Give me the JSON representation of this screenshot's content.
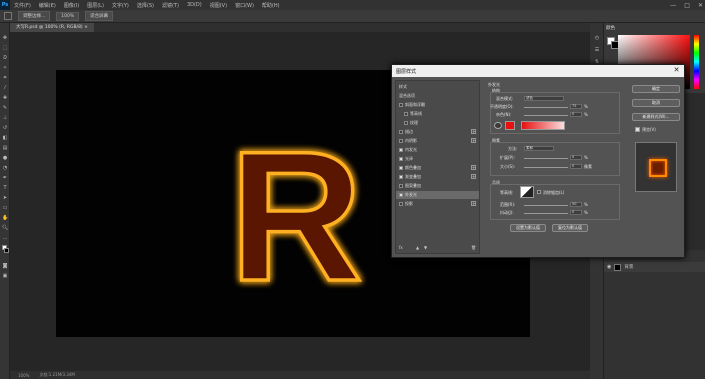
{
  "app": {
    "logo": "Ps"
  },
  "menu": [
    "文件(F)",
    "编辑(E)",
    "图像(I)",
    "图层(L)",
    "文字(Y)",
    "选择(S)",
    "滤镜(T)",
    "3D(D)",
    "视图(V)",
    "窗口(W)",
    "帮助(H)"
  ],
  "window_controls": {
    "minimize": "—",
    "maximize": "□",
    "close": "✕"
  },
  "options_bar": {
    "button1": "调整边缘...",
    "zoom": "100%",
    "button2": "适合屏幕"
  },
  "document_tab": "大写R.psd @ 100% (R, RGB/8) ×",
  "statusbar": {
    "zoom": "100%",
    "doc_info": "文档:1.21M/3.34M"
  },
  "color_panel": {
    "title": "颜色"
  },
  "canvas": {
    "glyph": "R",
    "glow_color": "#ff6a00",
    "fill_color": "#5a1800"
  },
  "dialog": {
    "title": "图层样式",
    "close": "✕",
    "styles": [
      {
        "label": "样式",
        "checked": null,
        "plus": false
      },
      {
        "label": "混合选项",
        "checked": null,
        "plus": false
      },
      {
        "label": "斜面和浮雕",
        "checked": false,
        "plus": false
      },
      {
        "label": "等高线",
        "checked": false,
        "plus": false
      },
      {
        "label": "纹理",
        "checked": false,
        "plus": false
      },
      {
        "label": "描边",
        "checked": false,
        "plus": true
      },
      {
        "label": "内阴影",
        "checked": false,
        "plus": true
      },
      {
        "label": "内发光",
        "checked": true,
        "plus": false
      },
      {
        "label": "光泽",
        "checked": true,
        "plus": false
      },
      {
        "label": "颜色叠加",
        "checked": true,
        "plus": true
      },
      {
        "label": "渐变叠加",
        "checked": true,
        "plus": true
      },
      {
        "label": "图案叠加",
        "checked": false,
        "plus": false
      },
      {
        "label": "外发光",
        "checked": true,
        "plus": false,
        "selected": true
      },
      {
        "label": "投影",
        "checked": false,
        "plus": true
      }
    ],
    "fx_label": "fx",
    "settings": {
      "section_title": "外发光",
      "structure": "结构",
      "blend_mode_label": "混合模式:",
      "blend_mode_value": "滤色",
      "opacity_label": "不透明度(O):",
      "opacity_value": "75",
      "noise_label": "杂色(N):",
      "noise_value": "0",
      "percent": "%",
      "elements": "图素",
      "method_label": "方法:",
      "method_value": "柔和",
      "spread_label": "扩展(P):",
      "spread_value": "0",
      "size_label": "大小(S):",
      "size_value": "0",
      "px": "像素",
      "quality": "品质",
      "contour_label": "等高线:",
      "antialias": "消除锯齿(L)",
      "range_label": "范围(R):",
      "range_value": "50",
      "jitter_label": "抖动(J):",
      "jitter_value": "0",
      "make_default": "设置为默认值",
      "reset_default": "复位为默认值",
      "glow_color": "#e81010"
    },
    "buttons": {
      "ok": "确定",
      "cancel": "取消",
      "new_style": "新建样式(W)...",
      "preview": "预览(V)"
    },
    "preview_checked": true
  },
  "layers": {
    "row_label": "背景"
  }
}
